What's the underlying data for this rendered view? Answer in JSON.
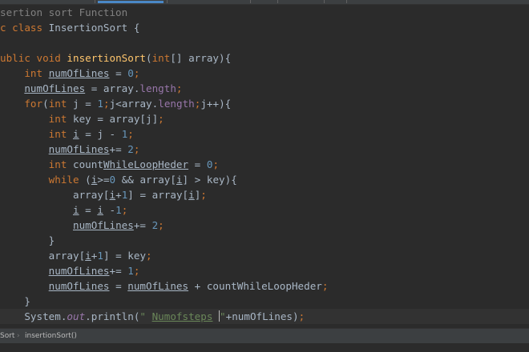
{
  "editor": {
    "lines": [
      "sertion sort Function",
      "c class InsertionSort {",
      "",
      "ublic void insertionSort(int[] array){",
      "    int numOfLines = 0;",
      "    numOfLines = array.length;",
      "    for(int j = 1;j<array.length;j++){",
      "        int key = array[j];",
      "        int i = j - 1;",
      "        numOfLines+= 2;",
      "        int countWhileLoopHeder = 0;",
      "        while (i>=0 && array[i] > key){",
      "            array[i+1] = array[i];",
      "            i = i -1;",
      "            numOfLines+= 2;",
      "        }",
      "        array[i+1] = key;",
      "        numOfLines+= 1;",
      "        numOfLines = numOfLines + countWhileLoopHeder;",
      "    }",
      "    System.out.println(\" Numofsteps \"+numOfLines);"
    ],
    "colors": {
      "background": "#2b2b2b",
      "text": "#a9b7c6",
      "keyword": "#cc7832",
      "function": "#ffc66d",
      "number": "#6897bb",
      "field": "#9876aa",
      "string": "#6a8759",
      "comment": "#808080",
      "caret_row": "#323232"
    }
  },
  "breadcrumb": {
    "class_name": "Sort",
    "method_name": "insertionSort()",
    "separator": "›"
  }
}
